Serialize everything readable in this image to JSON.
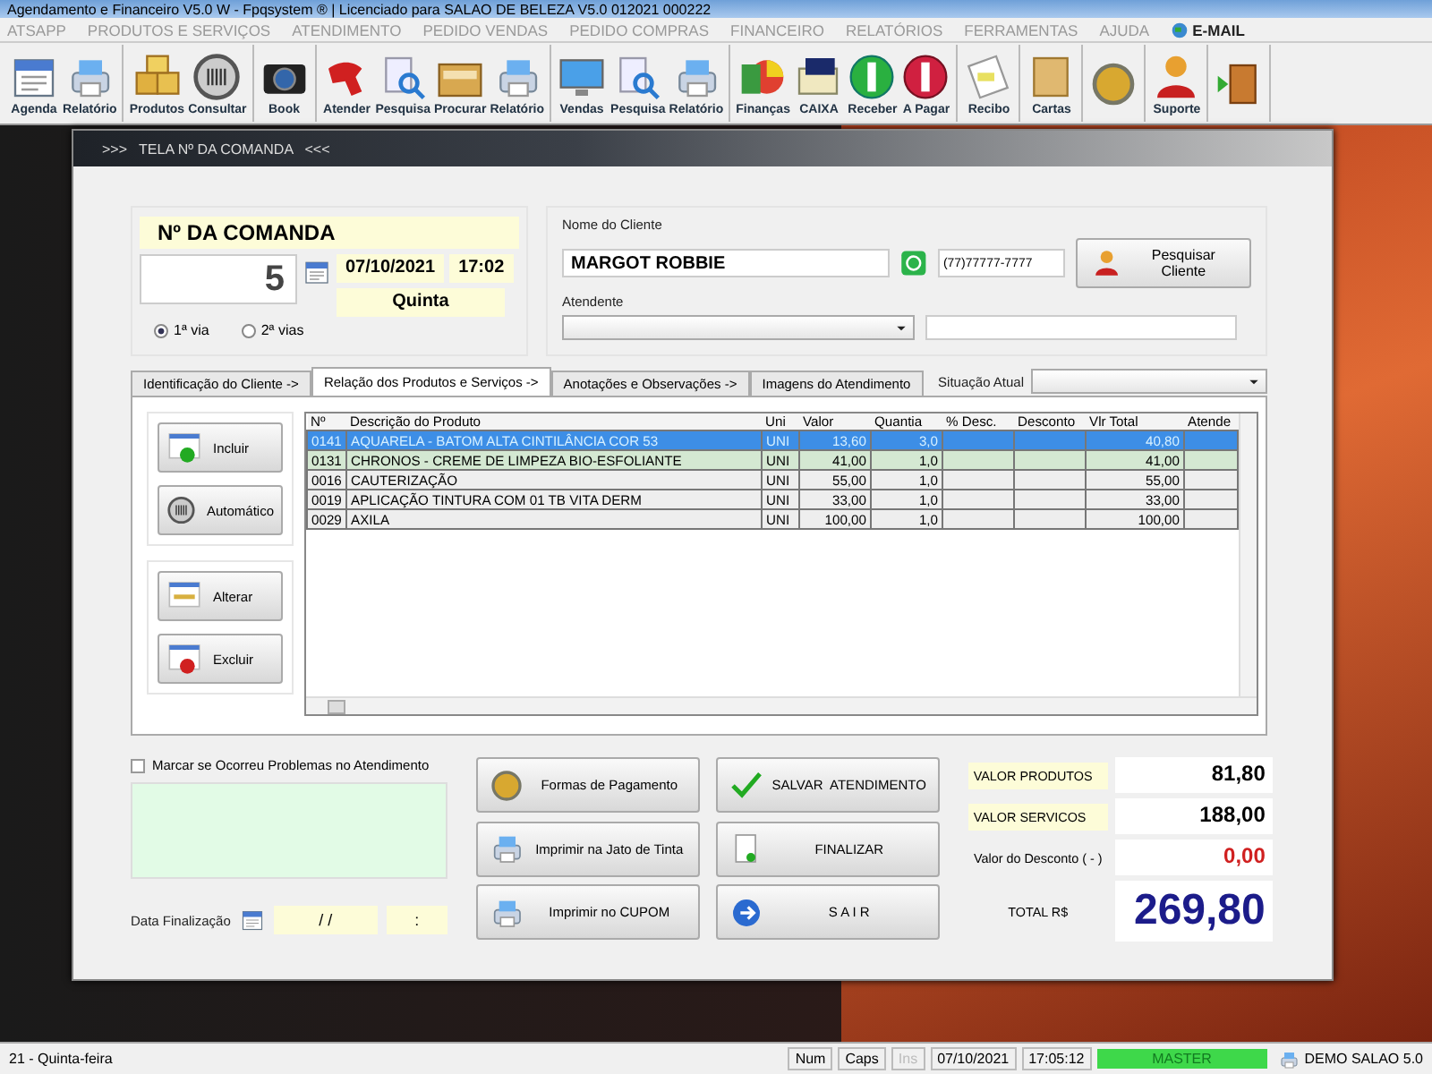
{
  "window": {
    "title": "Agendamento e Financeiro V5.0 W - Fpqsystem ® | Licenciado para SALAO DE BELEZA V5.0 012021 000222"
  },
  "menu": [
    "ATSAPP",
    "PRODUTOS E SERVIÇOS",
    "ATENDIMENTO",
    "PEDIDO VENDAS",
    "PEDIDO COMPRAS",
    "FINANCEIRO",
    "RELATÓRIOS",
    "FERRAMENTAS",
    "AJUDA",
    "E-MAIL"
  ],
  "toolbar": {
    "groups": [
      [
        {
          "kind": "labeled",
          "label": "Agenda"
        },
        {
          "kind": "labeled",
          "label": "Relatório"
        }
      ],
      [
        {
          "kind": "labeled",
          "label": "Produtos"
        },
        {
          "kind": "labeled",
          "label": "Consultar"
        }
      ],
      [
        {
          "kind": "labeled",
          "label": "Book"
        }
      ],
      [
        {
          "kind": "labeled",
          "label": "Atender"
        },
        {
          "kind": "labeled",
          "label": "Pesquisa"
        },
        {
          "kind": "labeled",
          "label": "Procurar"
        },
        {
          "kind": "labeled",
          "label": "Relatório"
        }
      ],
      [
        {
          "kind": "labeled",
          "label": "Vendas"
        },
        {
          "kind": "labeled",
          "label": "Pesquisa"
        },
        {
          "kind": "labeled",
          "label": "Relatório"
        }
      ],
      [
        {
          "kind": "labeled",
          "label": "Finanças"
        },
        {
          "kind": "labeled",
          "label": "CAIXA"
        },
        {
          "kind": "labeled",
          "label": "Receber"
        },
        {
          "kind": "labeled",
          "label": "A Pagar"
        }
      ],
      [
        {
          "kind": "labeled",
          "label": "Recibo"
        }
      ],
      [
        {
          "kind": "labeled",
          "label": "Cartas"
        }
      ],
      [
        {
          "kind": "icon_only"
        }
      ],
      [
        {
          "kind": "labeled",
          "label": "Suporte"
        }
      ],
      [
        {
          "kind": "icon_only"
        }
      ]
    ]
  },
  "dialog": {
    "title": ">>>   TELA Nº DA COMANDA   <<<",
    "comanda": {
      "heading": "Nº DA COMANDA",
      "number": "5",
      "date": "07/10/2021",
      "time": "17:02",
      "weekday": "Quinta",
      "copies": [
        {
          "label": "1ª via",
          "selected": true
        },
        {
          "label": "2ª vias",
          "selected": false
        }
      ]
    },
    "client": {
      "name_label": "Nome do Cliente",
      "name": "MARGOT ROBBIE",
      "phone": "(77)77777-7777",
      "search_button": "Pesquisar Cliente",
      "attendant_label": "Atendente"
    },
    "tabs": [
      {
        "label": "Identificação do Cliente ->",
        "selected": false
      },
      {
        "label": "Relação dos Produtos e Serviços ->",
        "selected": true
      },
      {
        "label": "Anotações e Observações ->",
        "selected": false
      },
      {
        "label": "Imagens do Atendimento",
        "selected": false
      }
    ],
    "situation_label": "Situação Atual",
    "side_buttons": [
      "Incluir",
      "Automático",
      "Alterar",
      "Excluir"
    ],
    "table": {
      "columns": [
        "Nº",
        "Descrição do Produto",
        "Uni",
        "Valor",
        "Quantia",
        "% Desc.",
        "Desconto",
        "Vlr Total",
        "Atende"
      ],
      "rows": [
        {
          "no": "0141",
          "description": "AQUARELA - BATOM ALTA CINTILÂNCIA COR 53",
          "unit": "UNI",
          "value": "13,60",
          "quantity": "3,0",
          "total": "40,80",
          "selected": true,
          "highlighted": false
        },
        {
          "no": "0131",
          "description": "CHRONOS - CREME DE LIMPEZA BIO-ESFOLIANTE",
          "unit": "UNI",
          "value": "41,00",
          "quantity": "1,0",
          "total": "41,00",
          "selected": false,
          "highlighted": true
        },
        {
          "no": "0016",
          "description": "CAUTERIZAÇÃO",
          "unit": "UNI",
          "value": "55,00",
          "quantity": "1,0",
          "total": "55,00",
          "selected": false,
          "highlighted": false
        },
        {
          "no": "0019",
          "description": "APLICAÇÃO TINTURA COM 01 TB VITA DERM",
          "unit": "UNI",
          "value": "33,00",
          "quantity": "1,0",
          "total": "33,00",
          "selected": false,
          "highlighted": false
        },
        {
          "no": "0029",
          "description": "AXILA",
          "unit": "UNI",
          "value": "100,00",
          "quantity": "1,0",
          "total": "100,00",
          "selected": false,
          "highlighted": false
        }
      ]
    },
    "problem_check": {
      "label": "Marcar se Ocorreu Problemas no Atendimento",
      "checked": false
    },
    "finish": {
      "label": "Data Finalização",
      "date": "/ /",
      "time": ":"
    },
    "actions": [
      "Formas de Pagamento",
      "SALVAR  ATENDIMENTO",
      "Imprimir na Jato de Tinta",
      "FINALIZAR",
      "Imprimir no CUPOM",
      "S A I R"
    ],
    "totals": {
      "products_label": "VALOR PRODUTOS",
      "products": "81,80",
      "services_label": "VALOR SERVICOS",
      "services": "188,00",
      "discount_label": "Valor do Desconto ( - )",
      "discount": "0,00",
      "total_label": "TOTAL R$",
      "total": "269,80"
    }
  },
  "status_bar": [
    {
      "text": "21 - Quinta-feira",
      "kind": "text",
      "disabled": false
    },
    {
      "text": "Num",
      "kind": "panel",
      "disabled": false
    },
    {
      "text": "Caps",
      "kind": "panel",
      "disabled": false
    },
    {
      "text": "Ins",
      "kind": "panel",
      "disabled": true
    },
    {
      "text": "07/10/2021",
      "kind": "panel",
      "disabled": false
    },
    {
      "text": "17:05:12",
      "kind": "panel",
      "disabled": false
    },
    {
      "text": "MASTER",
      "kind": "user",
      "disabled": false
    },
    {
      "text": "DEMO SALAO 5.0",
      "kind": "product",
      "disabled": false
    }
  ]
}
